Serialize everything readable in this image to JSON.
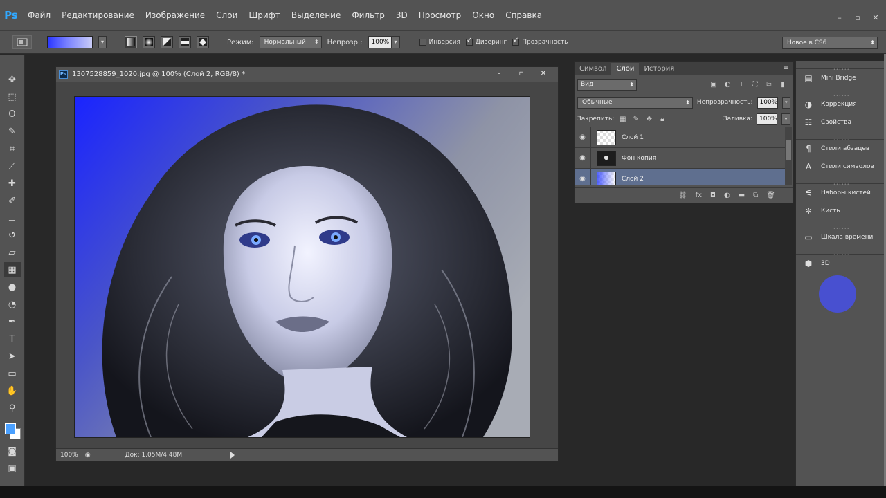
{
  "menu": {
    "logo": "Ps",
    "items": [
      "Файл",
      "Редактирование",
      "Изображение",
      "Слои",
      "Шрифт",
      "Выделение",
      "Фильтр",
      "3D",
      "Просмотр",
      "Окно",
      "Справка"
    ]
  },
  "window_controls": [
    "–",
    "▫",
    "✕"
  ],
  "options": {
    "mode_label": "Режим:",
    "mode_value": "Нормальный",
    "opacity_label": "Непрозр.:",
    "opacity_value": "100%",
    "inverse_label": "Инверсия",
    "dither_label": "Дизеринг",
    "transparency_label": "Прозрачность",
    "inverse_checked": false,
    "dither_checked": true,
    "transparency_checked": true,
    "workspace": "Новое в CS6",
    "gradient_colors": [
      "#2b37ff",
      "#c9ccf7"
    ]
  },
  "tools": [
    {
      "name": "move-tool-icon",
      "glyph": "✥"
    },
    {
      "name": "marquee-tool-icon",
      "glyph": "⬚"
    },
    {
      "name": "lasso-tool-icon",
      "glyph": "ʘ"
    },
    {
      "name": "quick-selection-tool-icon",
      "glyph": "✎"
    },
    {
      "name": "crop-tool-icon",
      "glyph": "⌗"
    },
    {
      "name": "eyedropper-tool-icon",
      "glyph": "⟋"
    },
    {
      "name": "healing-brush-tool-icon",
      "glyph": "✚"
    },
    {
      "name": "brush-tool-icon",
      "glyph": "✐"
    },
    {
      "name": "clone-stamp-tool-icon",
      "glyph": "⊥"
    },
    {
      "name": "history-brush-tool-icon",
      "glyph": "↺"
    },
    {
      "name": "eraser-tool-icon",
      "glyph": "▱"
    },
    {
      "name": "gradient-tool-icon",
      "glyph": "▦"
    },
    {
      "name": "blur-tool-icon",
      "glyph": "●"
    },
    {
      "name": "dodge-tool-icon",
      "glyph": "◔"
    },
    {
      "name": "pen-tool-icon",
      "glyph": "✒"
    },
    {
      "name": "type-tool-icon",
      "glyph": "T"
    },
    {
      "name": "path-selection-tool-icon",
      "glyph": "➤"
    },
    {
      "name": "shape-tool-icon",
      "glyph": "▭"
    },
    {
      "name": "hand-tool-icon",
      "glyph": "✋"
    },
    {
      "name": "zoom-tool-icon",
      "glyph": "⚲"
    }
  ],
  "colors": {
    "foreground": "#4aa0ff",
    "background": "#ffffff"
  },
  "document": {
    "title": "1307528859_1020.jpg @ 100% (Слой 2, RGB/8) *",
    "ps_badge": "Ps",
    "zoom": "100%",
    "doc_size": "Док: 1,05M/4,48M"
  },
  "layers_panel": {
    "tabs": [
      "Символ",
      "Слои",
      "История"
    ],
    "active_tab": 1,
    "kind_filter": "Вид",
    "blend_mode": "Обычные",
    "opacity_label": "Непрозрачность:",
    "opacity_value": "100%",
    "lock_label": "Закрепить:",
    "fill_label": "Заливка:",
    "fill_value": "100%",
    "layers": [
      {
        "name": "Слой 1",
        "thumb": "trans",
        "selected": false
      },
      {
        "name": "Фон копия",
        "thumb": "photo",
        "selected": false
      },
      {
        "name": "Слой 2",
        "thumb": "grad",
        "selected": true
      }
    ]
  },
  "dock": {
    "items": [
      {
        "label": "Mini Bridge",
        "icon": "mini-bridge-icon",
        "glyph": "▤"
      },
      {
        "label": "Коррекция",
        "icon": "adjustments-icon",
        "glyph": "◑"
      },
      {
        "label": "Свойства",
        "icon": "properties-icon",
        "glyph": "☷"
      },
      {
        "label": "Стили абзацев",
        "icon": "paragraph-styles-icon",
        "glyph": "¶"
      },
      {
        "label": "Стили символов",
        "icon": "character-styles-icon",
        "glyph": "A"
      },
      {
        "label": "Наборы кистей",
        "icon": "brush-presets-icon",
        "glyph": "⚟"
      },
      {
        "label": "Кисть",
        "icon": "brush-icon",
        "glyph": "✼"
      },
      {
        "label": "Шкала времени",
        "icon": "timeline-icon",
        "glyph": "▭"
      },
      {
        "label": "3D",
        "icon": "3d-icon",
        "glyph": "⬢"
      }
    ],
    "groups": [
      [
        0
      ],
      [
        1,
        2
      ],
      [
        3,
        4
      ],
      [
        5,
        6
      ],
      [
        7
      ],
      [
        8
      ]
    ]
  }
}
